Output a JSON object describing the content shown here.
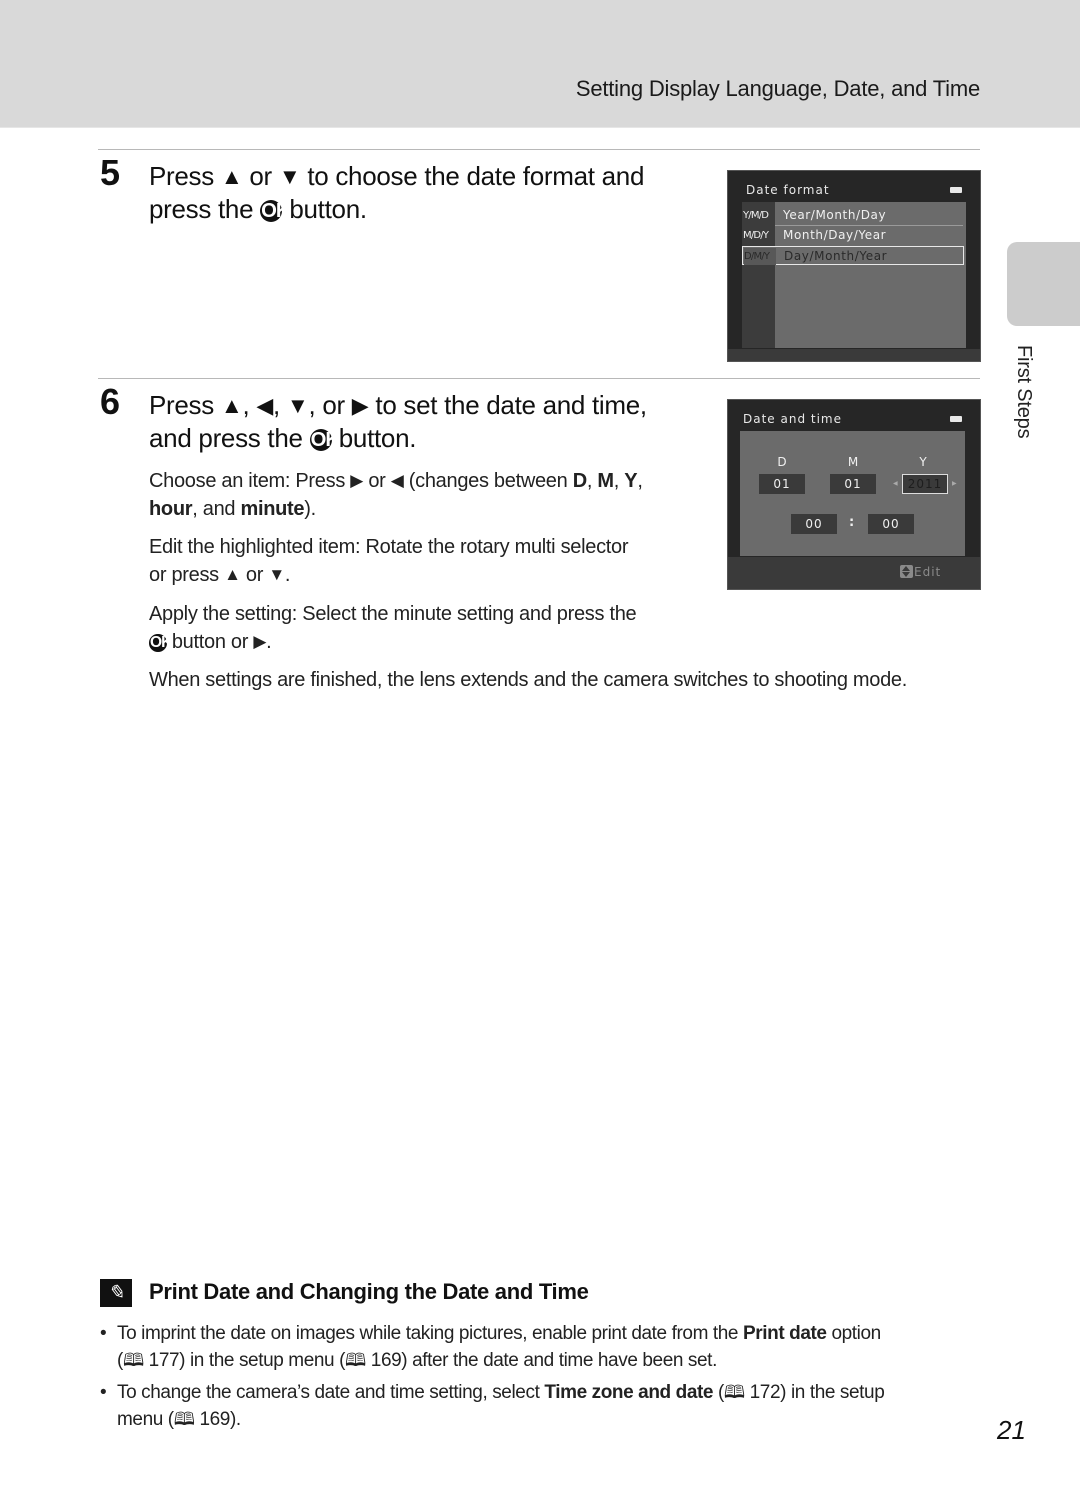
{
  "header": {
    "section_title": "Setting Display Language, Date, and Time"
  },
  "side_tab": {
    "label": "First Steps"
  },
  "step5": {
    "number": "5",
    "line1_a": "Press ",
    "line1_b": " or ",
    "line1_c": " to choose the date format and",
    "line2_a": "press the ",
    "line2_b": " button.",
    "screen": {
      "title": "Date format",
      "options": [
        {
          "code": "Y/M/D",
          "label": "Year/Month/Day",
          "selected": false
        },
        {
          "code": "M/D/Y",
          "label": "Month/Day/Year",
          "selected": false
        },
        {
          "code": "D/M/Y",
          "label": "Day/Month/Year",
          "selected": true
        }
      ]
    }
  },
  "step6": {
    "number": "6",
    "line1_a": "Press ",
    "line1_b": ", ",
    "line1_c": ", ",
    "line1_d": ", or ",
    "line1_e": " to set the date and time,",
    "line2_a": "and press the ",
    "line2_b": " button.",
    "choose": {
      "a": "Choose an item: Press ",
      "b": " or ",
      "c": " (changes between ",
      "d": "D",
      "e": ", ",
      "f": "M",
      "g": ", ",
      "h": "Y",
      "i": ",",
      "j": "hour",
      "k": ", and ",
      "l": "minute",
      "m": ")."
    },
    "edit": {
      "a": "Edit the highlighted item: Rotate the rotary multi selector",
      "b": "or press ",
      "c": " or ",
      "d": "."
    },
    "apply": {
      "a": "Apply the setting: Select the minute setting and press the",
      "b": " button or ",
      "c": "."
    },
    "finish": "When settings are finished, the lens extends and the camera switches to shooting mode.",
    "screen": {
      "title": "Date and time",
      "labels": {
        "d": "D",
        "m": "M",
        "y": "Y"
      },
      "day": "01",
      "month": "01",
      "year": "2011",
      "hour": "00",
      "colon": ":",
      "minute": "00",
      "edit_hint": "Edit"
    }
  },
  "symbols": {
    "up": "▲",
    "down": "▼",
    "left": "◀",
    "right": "▶",
    "ok": "OK",
    "book": "🕮",
    "bullet": "•",
    "note": "✎"
  },
  "note": {
    "title": "Print Date and Changing the Date and Time",
    "bullet1": {
      "a": "To imprint the date on images while taking pictures, enable print date from the ",
      "b": "Print date",
      "c": " option",
      "d": "(",
      "e": " 177) in the setup menu (",
      "f": " 169) after the date and time have been set."
    },
    "bullet2": {
      "a": "To change the camera’s date and time setting, select ",
      "b": "Time zone and date",
      "c": " (",
      "d": " 172) in the setup",
      "e": "menu (",
      "f": " 169)."
    }
  },
  "page_number": "21"
}
